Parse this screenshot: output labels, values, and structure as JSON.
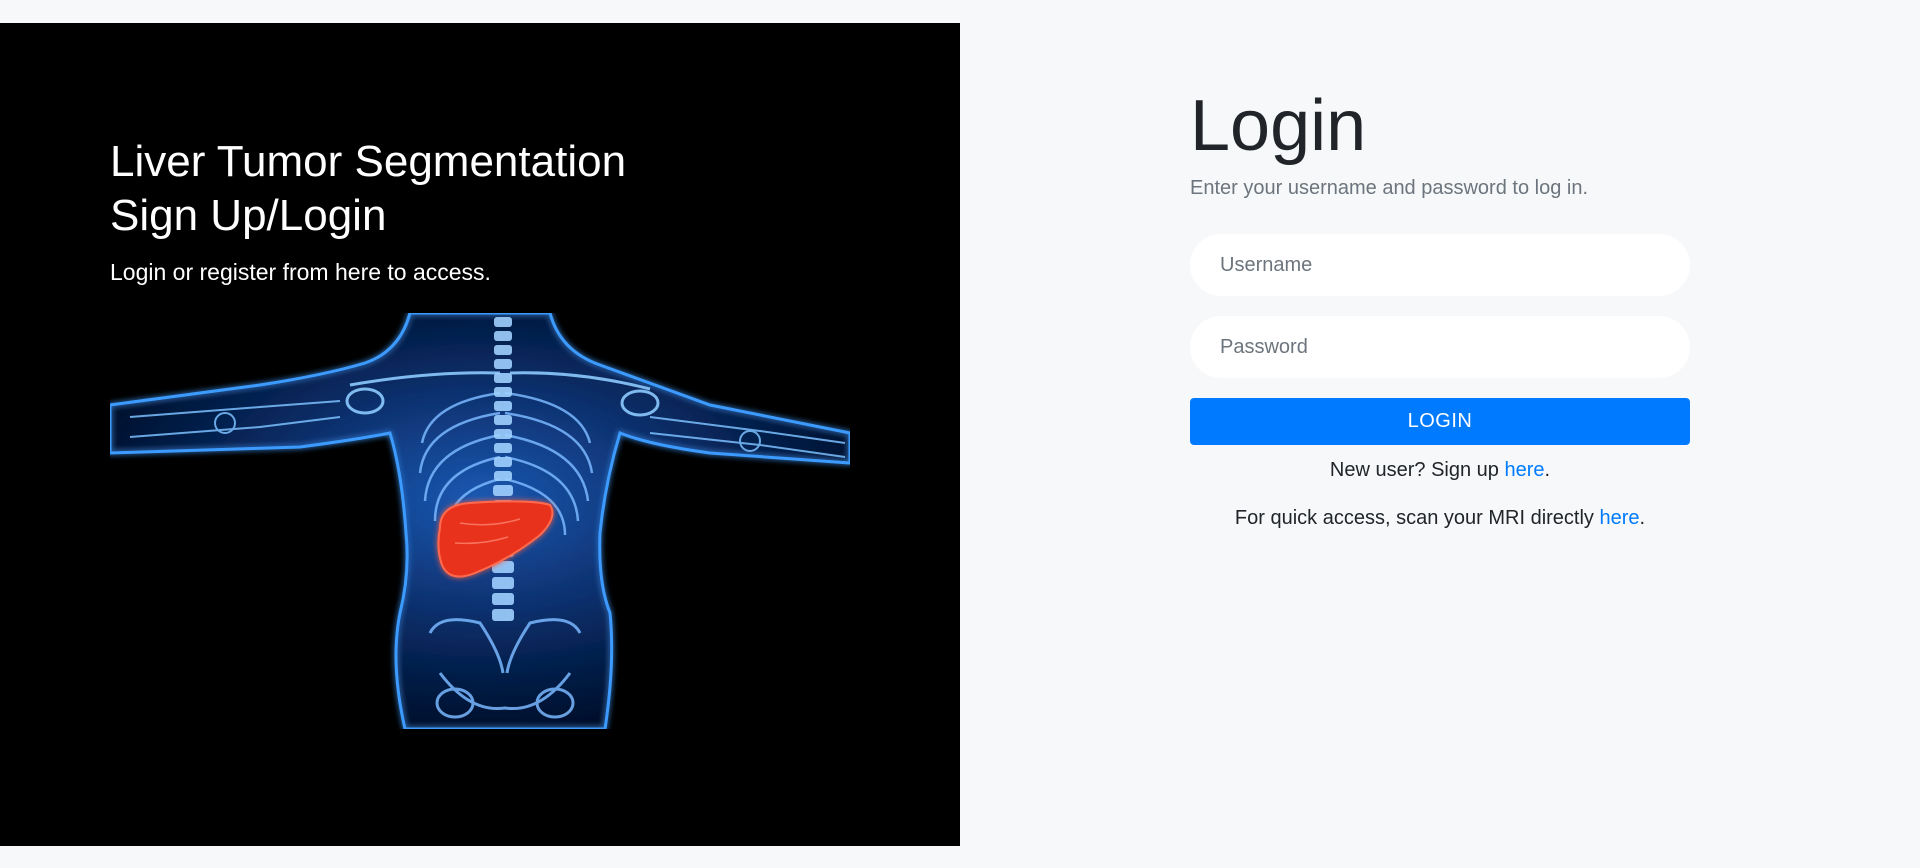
{
  "hero": {
    "title_line1": "Liver Tumor Segmentation",
    "title_line2": "Sign Up/Login",
    "subtitle": "Login or register from here to access."
  },
  "login": {
    "title": "Login",
    "subtitle": "Enter your username and password to log in.",
    "username_placeholder": "Username",
    "password_placeholder": "Password",
    "button_label": "LOGIN",
    "signup_prefix": "New user? Sign up ",
    "signup_link": "here",
    "signup_suffix": ".",
    "scan_prefix": "For quick access, scan your MRI directly ",
    "scan_link": "here",
    "scan_suffix": "."
  },
  "colors": {
    "accent": "#007bff",
    "panel": "#000000",
    "page_bg": "#f7f8fa",
    "skeleton": "#2a8cff",
    "liver": "#e8321f"
  },
  "icons": {
    "illustration": "human-body-xray-liver-icon"
  }
}
